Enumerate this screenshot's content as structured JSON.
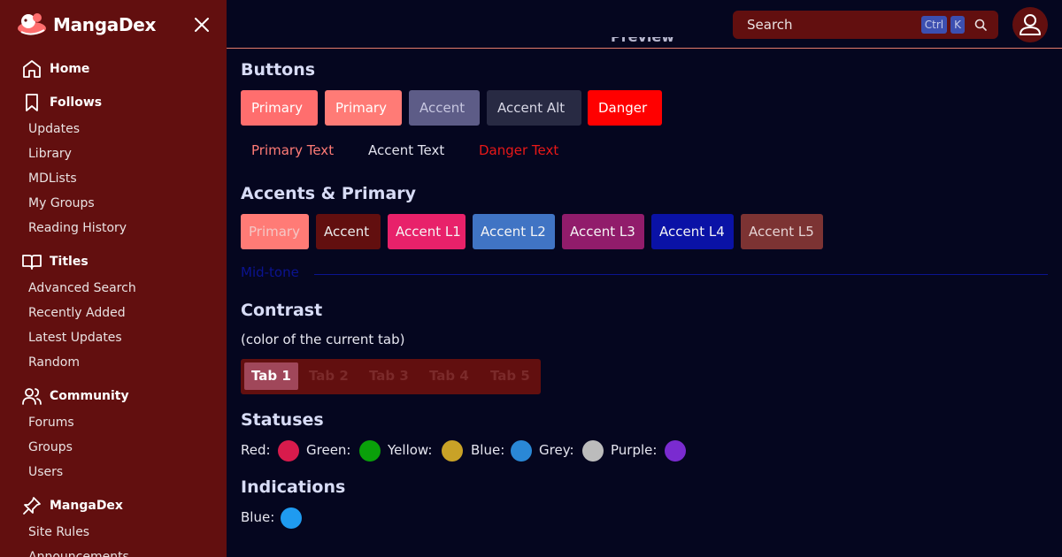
{
  "sidebar": {
    "brand": "MangaDex",
    "sections": [
      {
        "label": "Home"
      },
      {
        "label": "Follows",
        "items": [
          "Updates",
          "Library",
          "MDLists",
          "My Groups",
          "Reading History"
        ]
      },
      {
        "label": "Titles",
        "items": [
          "Advanced Search",
          "Recently Added",
          "Latest Updates",
          "Random"
        ]
      },
      {
        "label": "Community",
        "items": [
          "Forums",
          "Groups",
          "Users"
        ]
      },
      {
        "label": "MangaDex",
        "items": [
          "Site Rules",
          "Announcements"
        ]
      }
    ]
  },
  "topbar": {
    "search_placeholder": "Search",
    "kbd_ctrl": "Ctrl",
    "kbd_k": "K",
    "preview_heading": "Preview"
  },
  "buttons": {
    "heading": "Buttons",
    "filled": [
      {
        "label": "Primary",
        "bg": "#ff6e6e",
        "fg": "#ffffff"
      },
      {
        "label": "Primary",
        "bg": "#ff7b76",
        "fg": "#ffffff"
      },
      {
        "label": "Accent",
        "bg": "#5d5c87",
        "fg": "#c7c7e0"
      },
      {
        "label": "Accent Alt",
        "bg": "#282a43",
        "fg": "#d8d8e6"
      },
      {
        "label": "Danger",
        "bg": "#ff0000",
        "fg": "#ffffff"
      }
    ],
    "text": [
      {
        "label": "Primary Text",
        "color": "#ff7b76"
      },
      {
        "label": "Accent Text",
        "color": "#e2e2ee"
      },
      {
        "label": "Danger Text",
        "color": "#e81818"
      }
    ]
  },
  "accents": {
    "heading": "Accents & Primary",
    "swatches": [
      {
        "label": "Primary",
        "bg": "#ff7b76",
        "fg": "#f4c7c5"
      },
      {
        "label": "Accent",
        "bg": "#620f0f",
        "fg": "#ebebeb"
      },
      {
        "label": "Accent L1",
        "bg": "#e8216a",
        "fg": "#f5f5f5"
      },
      {
        "label": "Accent L2",
        "bg": "#4074c4",
        "fg": "#f5f5f5"
      },
      {
        "label": "Accent L3",
        "bg": "#911c6b",
        "fg": "#f5f5f5"
      },
      {
        "label": "Accent L4",
        "bg": "#0a12a6",
        "fg": "#f5f5f5"
      },
      {
        "label": "Accent L5",
        "bg": "#7c3333",
        "fg": "#e6d4d4"
      }
    ],
    "midtone_label": "Mid-tone"
  },
  "contrast": {
    "heading": "Contrast",
    "subtext": "(color of the current tab)",
    "tabs": [
      "Tab 1",
      "Tab 2",
      "Tab 3",
      "Tab 4",
      "Tab 5"
    ],
    "active_tab": "Tab 1"
  },
  "statuses": {
    "heading": "Statuses",
    "items": [
      {
        "label": "Red:",
        "color": "#d81b4c"
      },
      {
        "label": "Green:",
        "color": "#0aa00a"
      },
      {
        "label": "Yellow:",
        "color": "#c9a227"
      },
      {
        "label": "Blue:",
        "color": "#2a88d6"
      },
      {
        "label": "Grey:",
        "color": "#bcbcbc"
      },
      {
        "label": "Purple:",
        "color": "#7a2bd0"
      }
    ]
  },
  "indications": {
    "heading": "Indications",
    "items": [
      {
        "label": "Blue:",
        "color": "#1f9bf0"
      }
    ]
  }
}
